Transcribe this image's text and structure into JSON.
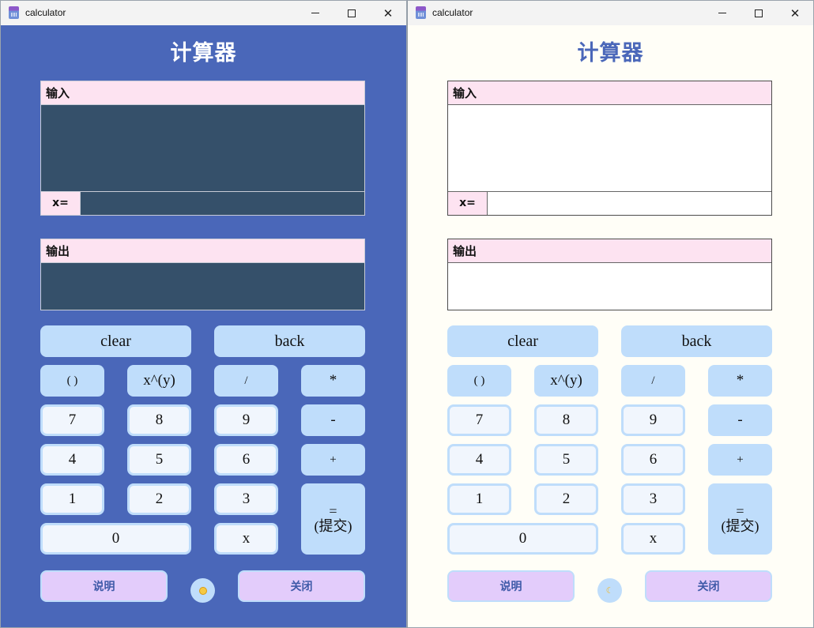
{
  "windows": [
    {
      "theme": "dark",
      "title": "calculator",
      "heading": "计算器",
      "input_label": "输入",
      "x_label": "x=",
      "output_label": "输出",
      "buttons": {
        "clear": "clear",
        "back": "back",
        "paren": "( )",
        "power": "x^(y)",
        "divide": "/",
        "multiply": "*",
        "n7": "7",
        "n8": "8",
        "n9": "9",
        "minus": "-",
        "n4": "4",
        "n5": "5",
        "n6": "6",
        "plus": "+",
        "n1": "1",
        "n2": "2",
        "n3": "3",
        "equals_line1": "=",
        "equals_line2": "(提交)",
        "n0": "0",
        "x": "x",
        "help": "说明",
        "close": "关闭"
      },
      "toggle_icon": "sun-icon"
    },
    {
      "theme": "light",
      "title": "calculator",
      "heading": "计算器",
      "input_label": "输入",
      "x_label": "x=",
      "output_label": "输出",
      "buttons": {
        "clear": "clear",
        "back": "back",
        "paren": "( )",
        "power": "x^(y)",
        "divide": "/",
        "multiply": "*",
        "n7": "7",
        "n8": "8",
        "n9": "9",
        "minus": "-",
        "n4": "4",
        "n5": "5",
        "n6": "6",
        "plus": "+",
        "n1": "1",
        "n2": "2",
        "n3": "3",
        "equals_line1": "=",
        "equals_line2": "(提交)",
        "n0": "0",
        "x": "x",
        "help": "说明",
        "close": "关闭"
      },
      "toggle_icon": "moon-icon"
    }
  ],
  "colors": {
    "dark_background": "#4a67b9",
    "light_background": "#fffef7",
    "dark_field": "#35506a",
    "label_pink": "#fde3f1",
    "button_blue": "#bfddfb",
    "number_button": "#f1f6fd",
    "footer_purple": "#e3ccfb",
    "heading_blue": "#4a67b9"
  }
}
